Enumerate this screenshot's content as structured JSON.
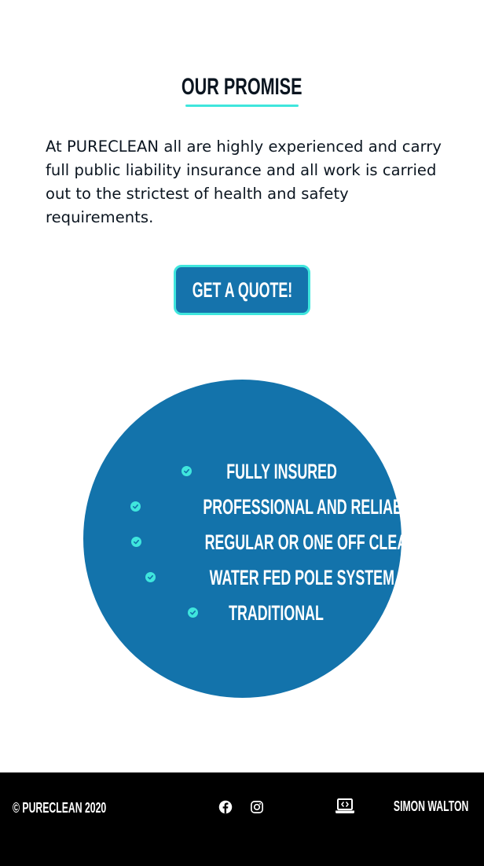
{
  "promise": {
    "title": "Our Promise",
    "text": "At PURECLEAN all are highly experienced and carry full public liability insurance and all work is carried out to the strictest of health and safety requirements.",
    "quote_button_label": "Get a Quote!"
  },
  "features": [
    {
      "label": "Fully Insured",
      "icon": "check-circle-icon"
    },
    {
      "label": "Professional and Reliable",
      "icon": "check-circle-icon"
    },
    {
      "label": "Regular or One Off Cleans",
      "icon": "check-circle-icon"
    },
    {
      "label": "Water Fed Pole System",
      "icon": "check-circle-icon"
    },
    {
      "label": "Traditional",
      "icon": "check-circle-icon"
    }
  ],
  "footer": {
    "copyright": "© PURECLEAN 2020",
    "social": [
      {
        "icon": "facebook-icon"
      },
      {
        "icon": "instagram-icon"
      }
    ],
    "credit": {
      "icon": "laptop-code-icon",
      "label": "Simon Walton"
    }
  },
  "colors": {
    "brand_blue": "#1373ab",
    "accent_cyan": "#3fe6dd",
    "text_dark": "#0b1520",
    "footer_bg": "#000000"
  }
}
